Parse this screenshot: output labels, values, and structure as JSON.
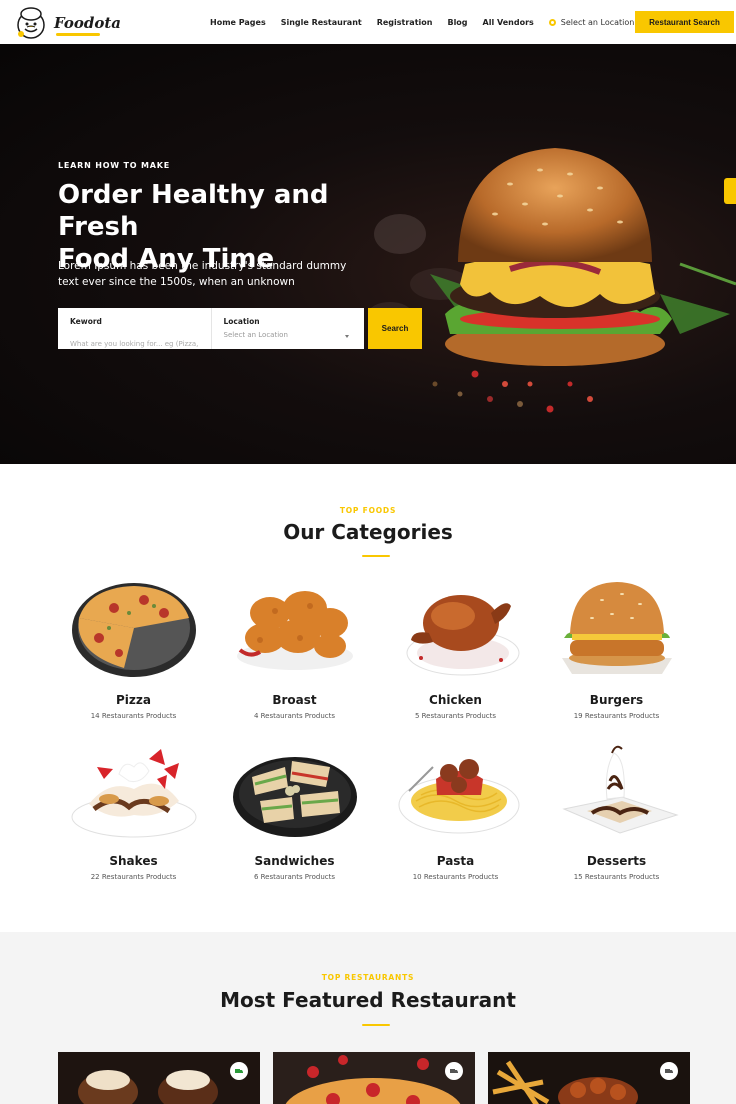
{
  "brand": {
    "name": "Foodota"
  },
  "nav": {
    "links": [
      "Home Pages",
      "Single Restaurant",
      "Registration",
      "Blog",
      "All Vendors"
    ],
    "location_label": "Select an Location",
    "cta_label": "Restaurant Search"
  },
  "hero": {
    "eyebrow": "LEARN HOW TO MAKE",
    "title_line1": "Order Healthy and Fresh",
    "title_line2": "Food Any Time",
    "description": "Lorem Ipsum has been the industry's standard dummy text ever since the 1500s, when an unknown",
    "search": {
      "keyword_label": "Keword",
      "keyword_placeholder": "What are you looking for... eg (Pizza,Burger)",
      "location_label": "Location",
      "location_value": "Select an Location",
      "button_label": "Search"
    }
  },
  "categories": {
    "eyebrow": "TOP FOODS",
    "title": "Our Categories",
    "items": [
      {
        "name": "Pizza",
        "count": "14 Restaurants Products"
      },
      {
        "name": "Broast",
        "count": "4 Restaurants Products"
      },
      {
        "name": "Chicken",
        "count": "5 Restaurants Products"
      },
      {
        "name": "Burgers",
        "count": "19 Restaurants Products"
      },
      {
        "name": "Shakes",
        "count": "22 Restaurants Products"
      },
      {
        "name": "Sandwiches",
        "count": "6 Restaurants Products"
      },
      {
        "name": "Pasta",
        "count": "10 Restaurants Products"
      },
      {
        "name": "Desserts",
        "count": "15 Restaurants Products"
      }
    ]
  },
  "featured": {
    "eyebrow": "TOP RESTAURANTS",
    "title": "Most Featured Restaurant"
  },
  "colors": {
    "accent": "#f9c700",
    "dark": "#1b1b1b",
    "hero_bg": "#0b0808"
  },
  "icons": [
    "chef-logo-icon",
    "location-pin-icon",
    "chevron-down-icon",
    "cart-tab-icon",
    "delivery-icon"
  ]
}
